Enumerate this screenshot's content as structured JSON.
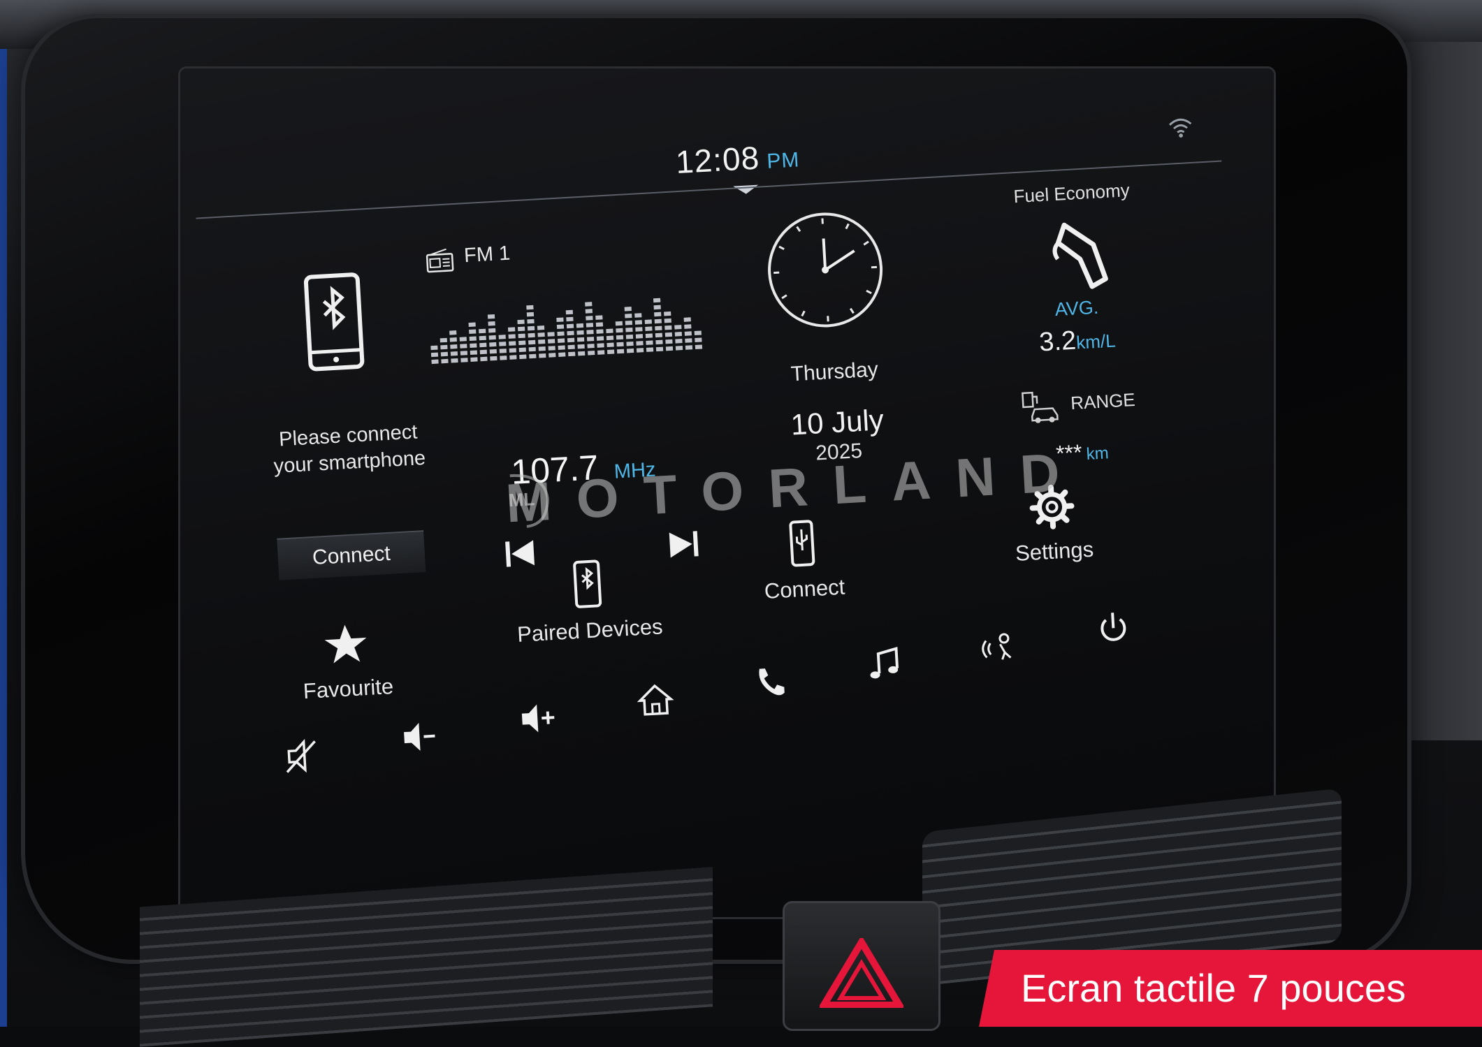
{
  "status_bar": {
    "time": "12:08",
    "ampm": "PM",
    "wifi_icon": "wifi-icon"
  },
  "bluetooth_panel": {
    "icon": "bluetooth-phone-icon",
    "message_line1": "Please connect",
    "message_line2": "your smartphone",
    "connect_label": "Connect"
  },
  "radio_panel": {
    "icon": "radio-icon",
    "band": "FM 1",
    "frequency": "107.7",
    "unit": "MHz",
    "prev_icon": "skip-previous-icon",
    "next_icon": "skip-next-icon"
  },
  "date_panel": {
    "clock_icon": "analog-clock-icon",
    "day": "Thursday",
    "date": "10 July",
    "year": "2025"
  },
  "fuel_panel": {
    "title": "Fuel Economy",
    "icon": "fuel-nozzle-icon",
    "avg_label": "AVG.",
    "avg_value": "3.2",
    "avg_unit": "km/L",
    "range_icon": "fuel-range-icon",
    "range_label": "RANGE",
    "range_value": "***",
    "range_unit": "km"
  },
  "shortcuts": {
    "favourite": "Favourite",
    "paired_devices": "Paired Devices",
    "connect": "Connect",
    "settings": "Settings"
  },
  "control_bar": {
    "mute_icon": "mute-icon",
    "volume_down_icon": "volume-down-icon",
    "volume_up_icon": "volume-up-icon",
    "home_icon": "home-icon",
    "phone_icon": "phone-icon",
    "music_icon": "music-note-icon",
    "voice_icon": "voice-command-icon",
    "power_icon": "power-icon"
  },
  "watermark": "MOTORLAND",
  "banner": "Ecran tactile 7 pouces",
  "colors": {
    "accent": "#4fb7e8",
    "banner": "#e5163a",
    "frame": "#1c3f8f"
  }
}
